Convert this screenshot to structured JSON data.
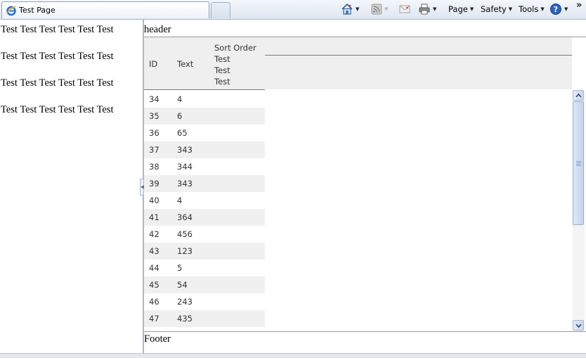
{
  "browser": {
    "tab_title": "Test Page",
    "commands": {
      "page": "Page",
      "safety": "Safety",
      "tools": "Tools"
    }
  },
  "left_pane": {
    "paragraphs": [
      "Test Test Test Test Test Test",
      "Test Test Test Test Test Test",
      "Test Test Test Test Test Test",
      "Test Test Test Test Test Test"
    ]
  },
  "right_pane": {
    "header": "header",
    "footer": "Footer",
    "table": {
      "columns": {
        "id": "ID",
        "text": "Text",
        "sort_order": "Sort Order",
        "sort_order_sub": [
          "Test",
          "Test",
          "Test"
        ]
      },
      "rows": [
        {
          "id": "34",
          "text": "4"
        },
        {
          "id": "35",
          "text": "6"
        },
        {
          "id": "36",
          "text": "65"
        },
        {
          "id": "37",
          "text": "343"
        },
        {
          "id": "38",
          "text": "344"
        },
        {
          "id": "39",
          "text": "343"
        },
        {
          "id": "40",
          "text": "4"
        },
        {
          "id": "41",
          "text": "364"
        },
        {
          "id": "42",
          "text": "456"
        },
        {
          "id": "43",
          "text": "123"
        },
        {
          "id": "44",
          "text": "5"
        },
        {
          "id": "45",
          "text": "54"
        },
        {
          "id": "46",
          "text": "243"
        },
        {
          "id": "47",
          "text": "435"
        }
      ]
    }
  }
}
